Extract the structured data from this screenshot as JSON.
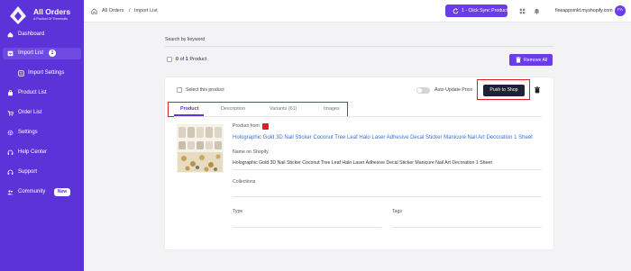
{
  "brand": {
    "title": "All Orders",
    "subtitle": "A Product Of Threecolts"
  },
  "sidebar": {
    "items": [
      {
        "label": "Dashboard",
        "icon": "home-icon"
      },
      {
        "label": "Import List",
        "icon": "import-list-icon",
        "badge": "1"
      },
      {
        "label": "Import Settings",
        "icon": "settings-sliders-icon"
      },
      {
        "label": "Product List",
        "icon": "shopping-bag-icon"
      },
      {
        "label": "Order List",
        "icon": "cart-icon"
      },
      {
        "label": "Settings",
        "icon": "gear-icon"
      },
      {
        "label": "Help Center",
        "icon": "headset-icon"
      },
      {
        "label": "Support",
        "icon": "support-icon"
      },
      {
        "label": "Community",
        "icon": "community-icon",
        "badge": "New"
      }
    ]
  },
  "header": {
    "breadcrumb": [
      "All Orders",
      "/",
      "Import List"
    ],
    "sync_label": "1 - Click Sync Product",
    "shop": "fineappsmkt.myshopify.com",
    "avatar": "FA"
  },
  "main": {
    "search_label": "Search by keyword",
    "count": {
      "selected": "0",
      "of": "of",
      "total": "1",
      "unit": "Product"
    },
    "remove_all": "Remove All"
  },
  "card": {
    "select_label": "Select this product",
    "auto_update_label": "Auto Update Price",
    "push_label": "Push to Shop",
    "tabs": [
      "Product",
      "Description",
      "Variants (61)",
      "Images"
    ],
    "product_from_label": "Product from",
    "title": "Holographic Gold 3D Nail Sticker Coconut Tree Leaf Halo Laser Adhesive Decal Sticker Manicure Nail Art Decoration 1 Sheet",
    "name_on_shopify_label": "Name on Shopify",
    "name_on_shopify": "Holographic Gold 3D Nail Sticker Coconut Tree Leaf Halo Laser Adhesive Decal Sticker Manicure Nail Art Decoration 1 Sheet",
    "collections_label": "Collections",
    "type_label": "Type",
    "tags_label": "Tags"
  },
  "colors": {
    "brand": "#5b33d9",
    "accent": "#6b3de6",
    "highlight": "#e02020",
    "link": "#3b6fe0"
  }
}
